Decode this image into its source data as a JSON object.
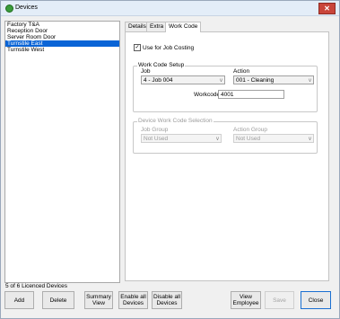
{
  "window": {
    "title": "Devices"
  },
  "devices": [
    {
      "label": "Factory T&A",
      "selected": false
    },
    {
      "label": "Reception Door",
      "selected": false
    },
    {
      "label": "Server Room Door",
      "selected": false
    },
    {
      "label": "Turnstile East",
      "selected": true
    },
    {
      "label": "Turnstile West",
      "selected": false
    }
  ],
  "tabs": [
    {
      "label": "Details",
      "active": false
    },
    {
      "label": "Extra",
      "active": false
    },
    {
      "label": "Work Code",
      "active": true
    }
  ],
  "workcode": {
    "use_for_costing_label": "Use for Job Costing",
    "use_for_costing_checked": true,
    "setup": {
      "legend": "Work Code Setup",
      "job_label": "Job",
      "job_value": "4 - Job 004",
      "action_label": "Action",
      "action_value": "001 - Cleaning",
      "workcode_label": "Workcode",
      "workcode_value": "4001"
    },
    "device_selection": {
      "legend": "Device Work Code Selection",
      "job_group_label": "Job Group",
      "job_group_value": "Not Used",
      "action_group_label": "Action Group",
      "action_group_value": "Not Used"
    }
  },
  "status": {
    "licence_text": "5 of 6 Licenced Devices"
  },
  "buttons": {
    "add": "Add",
    "delete": "Delete",
    "summary": "Summary\nView",
    "enable_all": "Enable all\nDevices",
    "disable_all": "Disable all\nDevices",
    "view_employee": "View\nEmployee",
    "save": "Save",
    "close": "Close"
  },
  "icons": {
    "app": "app-icon",
    "close": "close-icon",
    "dropdown": "chevron-down-icon"
  },
  "colors": {
    "selection": "#0a64d6",
    "close_button": "#c9453a",
    "titlebar": "#e3edf8"
  }
}
